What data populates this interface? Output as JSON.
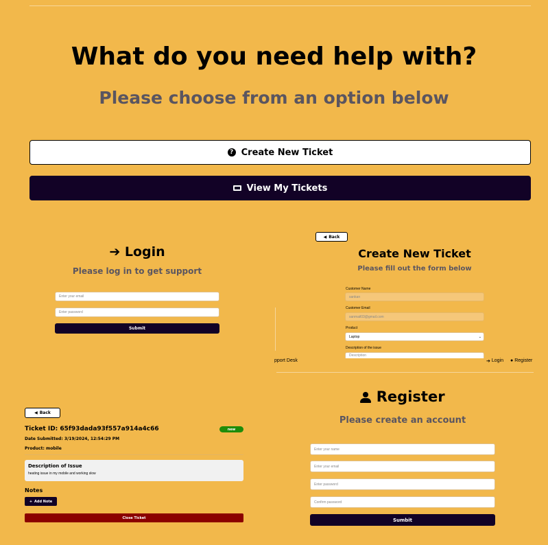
{
  "home": {
    "title": "What do you need help with?",
    "subtitle": "Please choose from an option below",
    "create_ticket": "Create New Ticket",
    "view_tickets": "View My Tickets"
  },
  "login": {
    "title": "Login",
    "subtitle": "Please log in to get support",
    "email_placeholder": "Enter your email",
    "password_placeholder": "Enter password",
    "submit": "Submit"
  },
  "new_ticket": {
    "back": "Back",
    "title": "Create New Ticket",
    "subtitle": "Please fill out the form below",
    "customer_name_label": "Customer Name",
    "customer_name_value": "sankan",
    "customer_email_label": "Customer Email",
    "customer_email_value": "sanmail03@gmail.com",
    "product_label": "Product",
    "product_value": "Laptop",
    "description_label": "Description of the issue",
    "description_placeholder": "Description"
  },
  "navbar": {
    "brand_fragment": "pport Desk",
    "login": "Login",
    "register": "Register"
  },
  "ticket": {
    "back": "Back",
    "id_line": "Ticket ID: 65f93dada93f557a914a4c66",
    "status": "new",
    "date_line": "Date Submitted: 3/19/2024, 12:54:29 PM",
    "product_line": "Product: mobile",
    "description_heading": "Description of Issue",
    "description_text": "heating issue in my mobile and working slow",
    "notes_heading": "Notes",
    "add_note": "Add Note",
    "close_ticket": "Close Ticket",
    "status_color": "#1f8c0a",
    "close_color": "#8b0000"
  },
  "register": {
    "title": "Register",
    "subtitle": "Please create an account",
    "name_placeholder": "Enter your name",
    "email_placeholder": "Enter your email",
    "password_placeholder": "Enter password",
    "confirm_placeholder": "Confirm password",
    "submit": "Sumbit"
  }
}
